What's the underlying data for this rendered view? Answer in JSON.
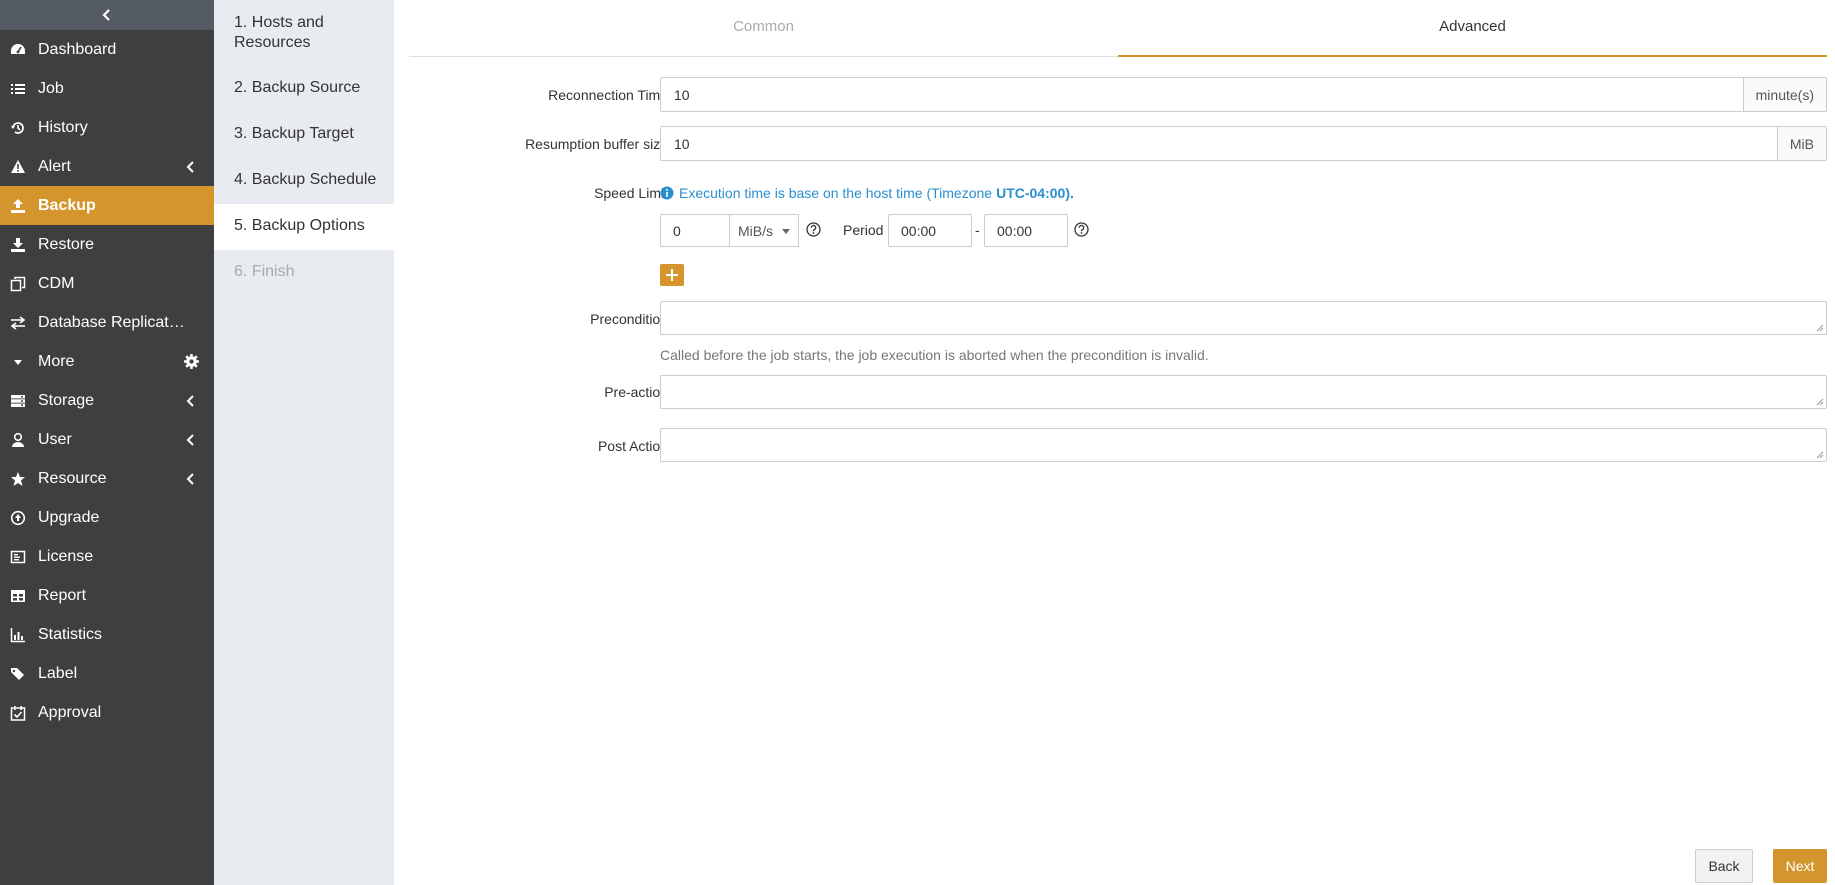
{
  "sidebar": {
    "items": [
      {
        "label": "Dashboard",
        "icon": "dashboard-icon"
      },
      {
        "label": "Job",
        "icon": "list-icon"
      },
      {
        "label": "History",
        "icon": "history-icon"
      },
      {
        "label": "Alert",
        "icon": "alert-icon"
      },
      {
        "label": "Backup",
        "icon": "upload-icon"
      },
      {
        "label": "Restore",
        "icon": "download-icon"
      },
      {
        "label": "CDM",
        "icon": "copy-icon"
      },
      {
        "label": "Database Replication",
        "icon": "exchange-icon"
      },
      {
        "label": "More",
        "icon": "caret-down-icon"
      },
      {
        "label": "Storage",
        "icon": "storage-icon"
      },
      {
        "label": "User",
        "icon": "user-icon"
      },
      {
        "label": "Resource",
        "icon": "star-icon"
      },
      {
        "label": "Upgrade",
        "icon": "upgrade-icon"
      },
      {
        "label": "License",
        "icon": "license-icon"
      },
      {
        "label": "Report",
        "icon": "table-icon"
      },
      {
        "label": "Statistics",
        "icon": "bar-chart-icon"
      },
      {
        "label": "Label",
        "icon": "tags-icon"
      },
      {
        "label": "Approval",
        "icon": "calendar-check-icon"
      }
    ],
    "active": "Backup",
    "accent_color": "#d4952c",
    "background_color": "#3f3f3f"
  },
  "steps": [
    {
      "label": "1. Hosts and Resources"
    },
    {
      "label": "2. Backup Source"
    },
    {
      "label": "3. Backup Target"
    },
    {
      "label": "4. Backup Schedule"
    },
    {
      "label": "5. Backup Options"
    },
    {
      "label": "6. Finish"
    }
  ],
  "tabs": {
    "common": "Common",
    "advanced": "Advanced",
    "active": "Advanced"
  },
  "form": {
    "reconnection": {
      "label": "Reconnection Time",
      "value": "10",
      "unit": "minute(s)"
    },
    "resumption": {
      "label": "Resumption buffer size",
      "value": "10",
      "unit": "MiB"
    },
    "speed": {
      "label": "Speed Limit",
      "info_text": "Execution time is base on the host time (Timezone",
      "timezone": "UTC-04:00).",
      "value": "0",
      "unit": "MiB/s",
      "period_label": "Period",
      "period_start": "00:00",
      "dash": "-",
      "period_end": "00:00"
    },
    "precondition": {
      "label": "Precondition",
      "help": "Called before the job starts, the job execution is aborted when the precondition is invalid."
    },
    "preaction": {
      "label": "Pre-action"
    },
    "postaction": {
      "label": "Post Action"
    }
  },
  "buttons": {
    "back": "Back",
    "next": "Next"
  }
}
